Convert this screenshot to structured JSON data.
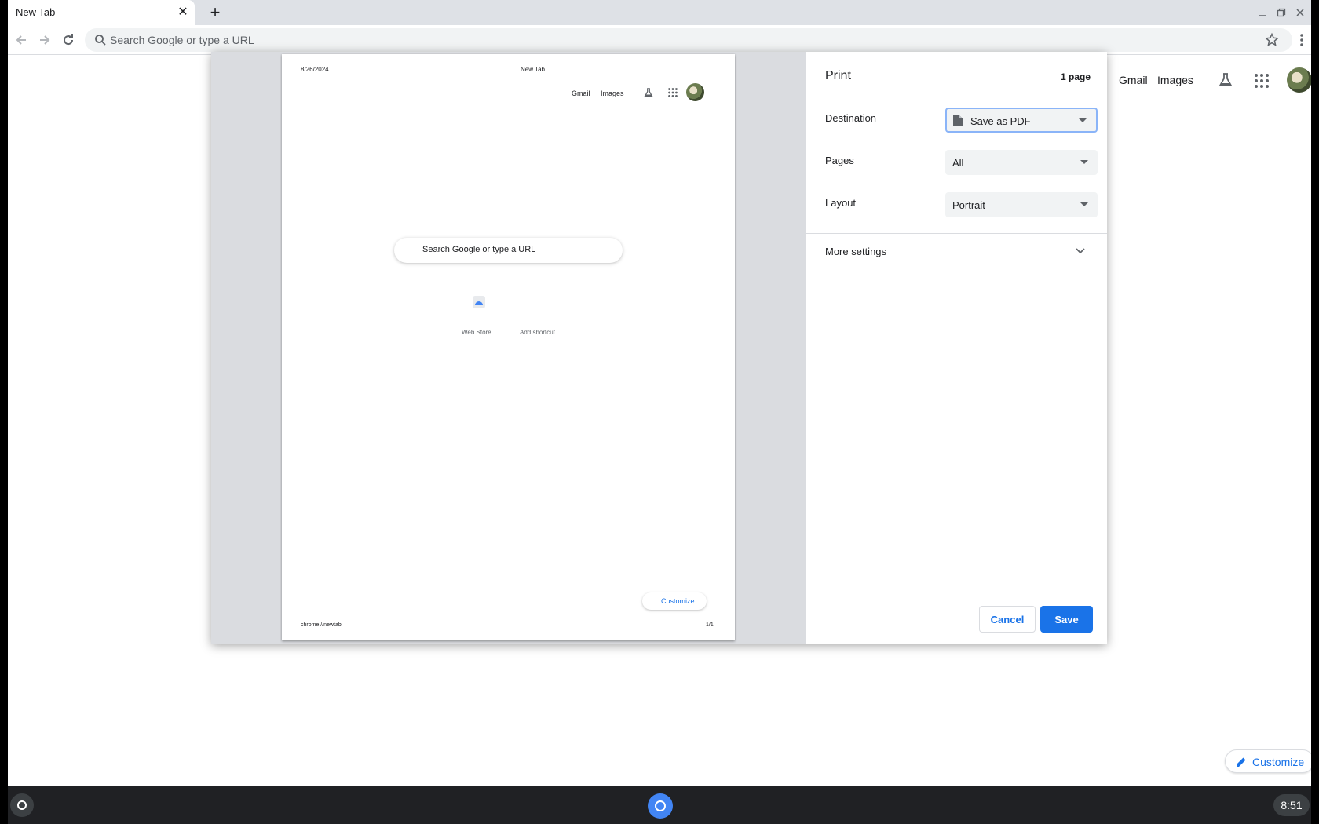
{
  "browser": {
    "tab_title": "New Tab",
    "omnibox_placeholder": "Search Google or type a URL"
  },
  "ntp": {
    "gmail": "Gmail",
    "images": "Images",
    "customize": "Customize"
  },
  "print_preview": {
    "date": "8/26/2024",
    "title": "New Tab",
    "gmail": "Gmail",
    "images": "Images",
    "search_placeholder": "Search Google or type a URL",
    "shortcut_webstore": "Web Store",
    "shortcut_add": "Add shortcut",
    "customize": "Customize",
    "url": "chrome://newtab",
    "page_number": "1/1"
  },
  "print_settings": {
    "title": "Print",
    "page_count": "1 page",
    "destination_label": "Destination",
    "destination_value": "Save as PDF",
    "pages_label": "Pages",
    "pages_value": "All",
    "layout_label": "Layout",
    "layout_value": "Portrait",
    "more_settings": "More settings",
    "cancel": "Cancel",
    "save": "Save"
  },
  "shelf": {
    "time": "8:51"
  },
  "colors": {
    "accent": "#1a73e8",
    "shelf": "#202124"
  }
}
